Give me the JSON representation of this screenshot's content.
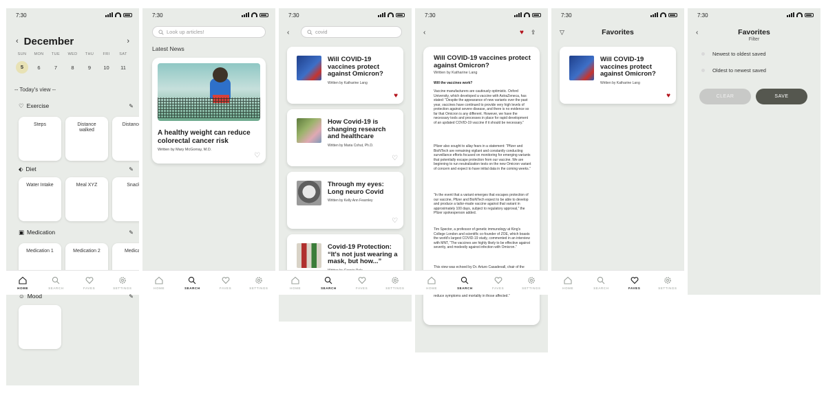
{
  "time": "7:30",
  "nav": [
    "HOME",
    "SEARCH",
    "FAVES",
    "SETTINGS"
  ],
  "home": {
    "month": "December",
    "week": [
      {
        "day": "SUN",
        "date": "5"
      },
      {
        "day": "MON",
        "date": "6"
      },
      {
        "day": "TUE",
        "date": "7"
      },
      {
        "day": "WED",
        "date": "8"
      },
      {
        "day": "THU",
        "date": "9"
      },
      {
        "day": "FRI",
        "date": "10"
      },
      {
        "day": "SAT",
        "date": "11"
      }
    ],
    "todays_view": "-- Today's view --",
    "sections": {
      "exercise": {
        "title": "Exercise",
        "cards": [
          "Steps",
          "Distance walked",
          "Distance c"
        ]
      },
      "diet": {
        "title": "Diet",
        "cards": [
          "Water Intake",
          "Meal XYZ",
          "Snack"
        ]
      },
      "medication": {
        "title": "Medication",
        "cards": [
          "Medication 1",
          "Medication 2",
          "Medicati"
        ]
      },
      "mood": {
        "title": "Mood"
      }
    }
  },
  "search": {
    "placeholder": "Look up articles!",
    "latest": "Latest News",
    "featured": {
      "title": "A healthy weight can reduce colorectal cancer risk",
      "author": "Written by Mary McGorray, M.D."
    }
  },
  "results": {
    "query": "covid",
    "items": [
      {
        "title": "Will COVID-19 vaccines protect against Omicron?",
        "author": "Written by Katharine Lang",
        "liked": true
      },
      {
        "title": "How Covid-19 is changing research and healthcare",
        "author": "Written by Maria Cohut, Ph.D.",
        "liked": false
      },
      {
        "title": "Through my eyes: Long neuro Covid",
        "author": "Written by Kelly Ann Fearnley",
        "liked": false
      },
      {
        "title": "Covid-19 Protection: “It's not just wearing a mask, but how...”",
        "author": "Written by Connie Pelc",
        "liked": false
      }
    ]
  },
  "article": {
    "title": "Will COVID-19 vaccines protect against Omicron?",
    "author": "Written by Katharine Lang",
    "subhead": "Will the vaccines work?",
    "p1": "Vaccine manufacturers are cautiously optimistic. Oxford University, which developed a vaccine with AstraZeneca, has stated: “Despite the appearance of new variants over the past year, vaccines have continued to provide very high levels of protection against severe disease, and there is no evidence so far that Omicron is any different. However, we have the necessary tools and processes in place for rapid development of an updated COVID-19 vaccine if it should be necessary.”",
    "p2": "Pfizer also sought to allay fears in a statement: “Pfizer and BioNTech are remaining vigilant and constantly conducting surveillance efforts focused on monitoring for emerging variants that potentially escape protection from our vaccine. We are beginning to run neutralization tests on the new Omicron variant of concern and expect to have initial data in the coming weeks.”",
    "p3": "“In the event that a variant emerges that escapes protection of our vaccine, Pfizer and BioNTech expect to be able to develop and produce a tailor-made vaccine against that variant in approximately 100 days, subject to regulatory approval,” the Pfizer spokesperson added.",
    "p4": "Tim Spector, a professor of genetic immunology at King's College London and scientific co-founder of ZOE, which boasts the world's largest COVID-19 study, commented in an interview with MNT, “The vaccines are highly likely to be effective against severity, and modestly against infection with Omicron.”",
    "p5": "This view was echoed by Dr. Arturo Casadevall, chair of the molecular microbiology and immunology department at the Johns Hopkins",
    "tail": "reduce symptoms and mortality in those affected.”"
  },
  "favorites": {
    "title": "Favorites",
    "item": {
      "title": "Will COVID-19 vaccines protect against Omicron?",
      "author": "Written by Katharine Lang"
    }
  },
  "filter": {
    "title": "Favorites",
    "subtitle": "Filter",
    "options": [
      "Newest to oldest saved",
      "Oldest to newest saved"
    ],
    "clear": "CLEAR",
    "save": "SAVE"
  },
  "colors": {
    "heart": "#b3121b",
    "background": "#e9ece8",
    "save_button": "#55574f"
  }
}
